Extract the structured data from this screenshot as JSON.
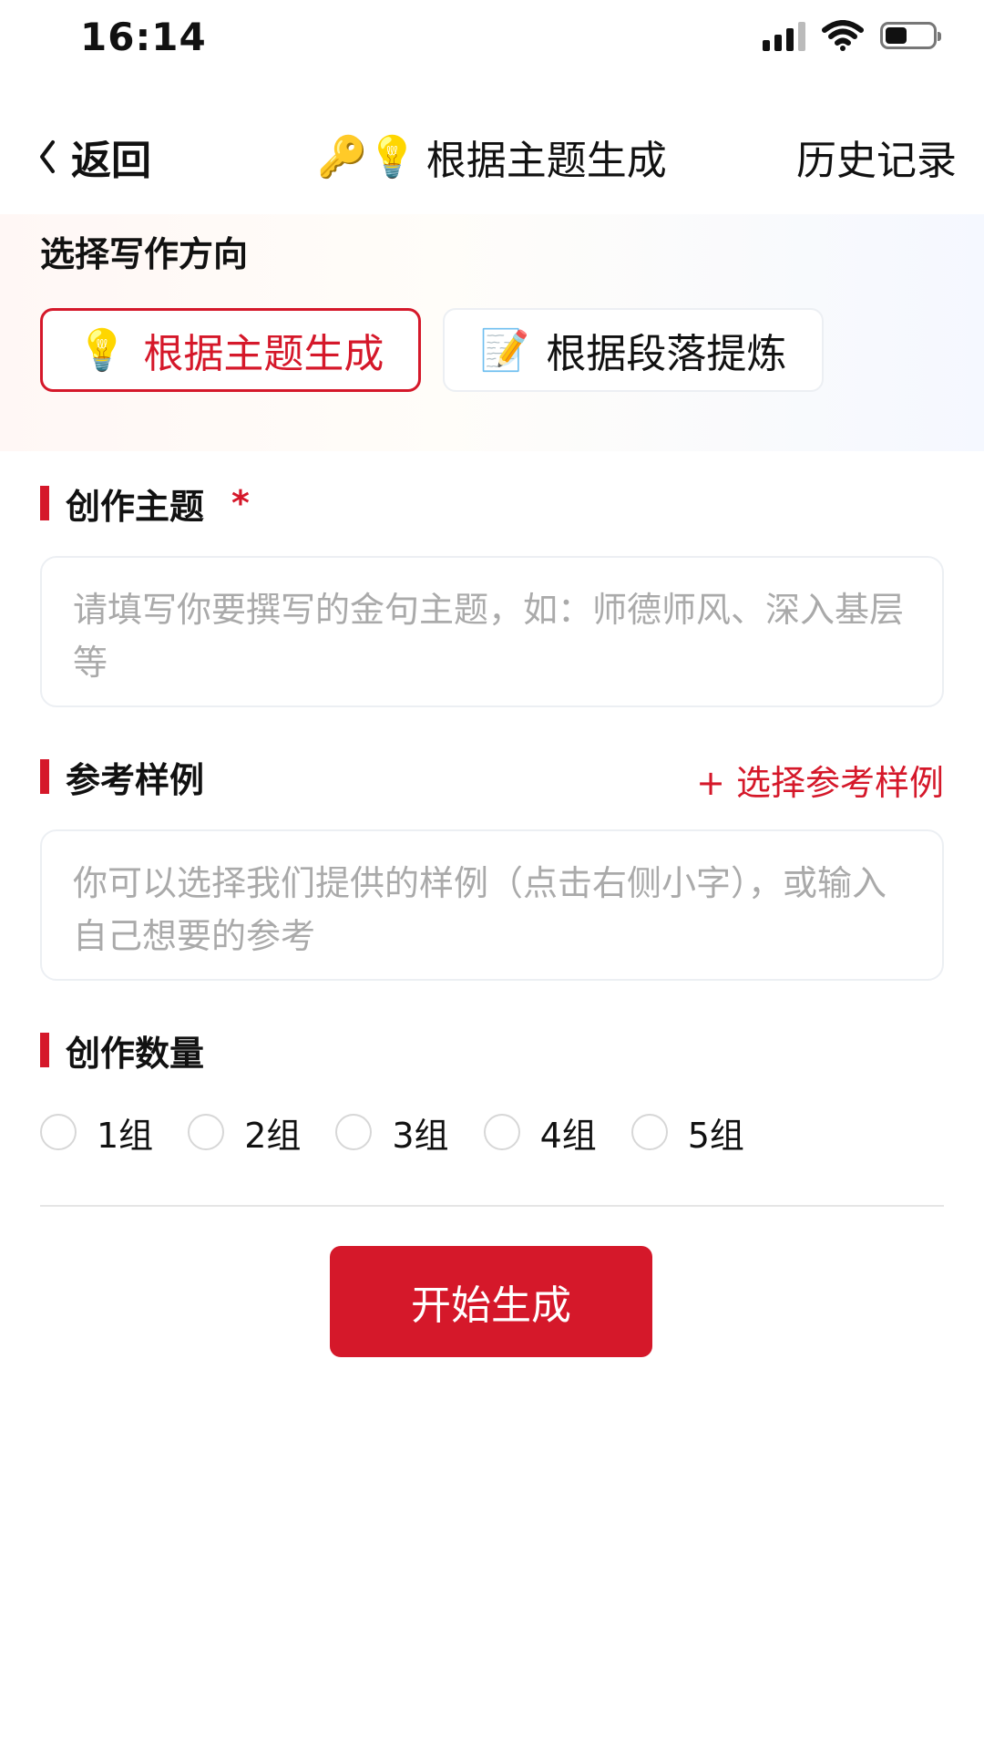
{
  "status_bar": {
    "time": "16:14",
    "signal_icon": "signal-icon",
    "wifi_icon": "wifi-icon",
    "battery_icon": "battery-icon",
    "battery_level": 0.45
  },
  "nav": {
    "back_label": "返回",
    "title_emojis": "🔑💡",
    "title": "根据主题生成",
    "history_label": "历史记录"
  },
  "direction": {
    "label": "选择写作方向",
    "options": [
      {
        "emoji": "💡",
        "label": "根据主题生成",
        "selected": true
      },
      {
        "emoji": "📝",
        "label": "根据段落提炼",
        "selected": false
      }
    ]
  },
  "fields": {
    "theme": {
      "label": "创作主题",
      "required_mark": "*",
      "placeholder": "请填写你要撰写的金句主题，如：师德师风、深入基层等"
    },
    "reference": {
      "label": "参考样例",
      "select_link": "+ 选择参考样例",
      "placeholder": "你可以选择我们提供的样例（点击右侧小字），或输入自己想要的参考"
    },
    "quantity": {
      "label": "创作数量",
      "options": [
        "1组",
        "2组",
        "3组",
        "4组",
        "5组"
      ]
    }
  },
  "actions": {
    "start_label": "开始生成"
  },
  "colors": {
    "accent": "#d5182a",
    "border": "#eceff3",
    "placeholder": "#aaaaaa"
  }
}
